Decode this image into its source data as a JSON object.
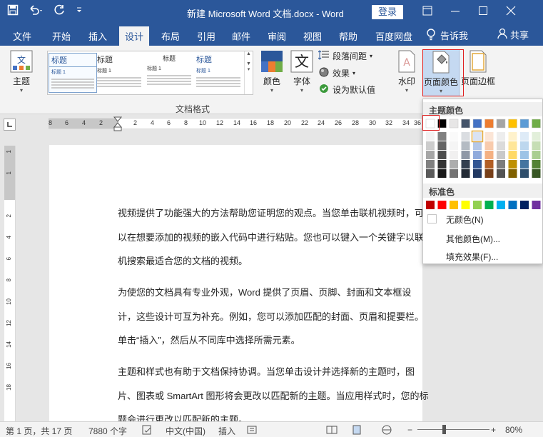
{
  "window": {
    "title": "新建 Microsoft Word 文档.docx  -  Word",
    "login": "登录"
  },
  "tabs": [
    {
      "label": "文件"
    },
    {
      "label": "开始"
    },
    {
      "label": "插入"
    },
    {
      "label": "设计"
    },
    {
      "label": "布局"
    },
    {
      "label": "引用"
    },
    {
      "label": "邮件"
    },
    {
      "label": "审阅"
    },
    {
      "label": "视图"
    },
    {
      "label": "帮助"
    },
    {
      "label": "百度网盘"
    }
  ],
  "tell_me": "告诉我",
  "share": "共享",
  "ribbon": {
    "theme": "主题",
    "colors": "颜色",
    "fonts": "字体",
    "paragraph_spacing": "段落间距",
    "effects": "效果",
    "set_default": "设为默认值",
    "watermark": "水印",
    "page_color": "页面颜色",
    "page_borders": "页面边框",
    "group_label": "文档格式",
    "styles": [
      {
        "name": "标题",
        "heading": "标题 1"
      },
      {
        "name": "标题",
        "heading": "标题 1"
      },
      {
        "name": "标题",
        "heading": "标题 1"
      },
      {
        "name": "标题",
        "heading": "标题 1"
      }
    ]
  },
  "ruler_h": [
    "8",
    "6",
    "4",
    "2",
    "2",
    "4",
    "6",
    "8",
    "10",
    "12",
    "14",
    "16",
    "18",
    "20",
    "22",
    "24",
    "26",
    "28",
    "30",
    "32",
    "34",
    "36"
  ],
  "ruler_v": [
    "1",
    "1",
    "2",
    "4",
    "6",
    "8",
    "10",
    "12",
    "14",
    "16",
    "18"
  ],
  "document": {
    "paragraphs": [
      "视频提供了功能强大的方法帮助您证明您的观点。当您单击联机视频时，可以在想要添加的视频的嵌入代码中进行粘贴。您也可以键入一个关键字以联机搜索最适合您的文档的视频。",
      "为使您的文档具有专业外观，Word 提供了页眉、页脚、封面和文本框设计，这些设计可互为补充。例如，您可以添加匹配的封面、页眉和提要栏。单击“插入”，然后从不同库中选择所需元素。",
      "主题和样式也有助于文档保持协调。当您单击设计并选择新的主题时，图片、图表或 SmartArt 图形将会更改以匹配新的主题。当应用样式时，您的标题会进行更改以匹配新的主题。"
    ]
  },
  "color_menu": {
    "theme_header": "主题颜色",
    "standard_header": "标准色",
    "no_color": "无颜色(N)",
    "more_colors": "其他颜色(M)...",
    "fill_effects": "填充效果(F)...",
    "theme_top": [
      "#ffffff",
      "#000000",
      "#e7e6e6",
      "#44546a",
      "#4472c4",
      "#ed7d31",
      "#a5a5a5",
      "#ffc000",
      "#5b9bd5",
      "#70ad47"
    ],
    "standard": [
      "#c00000",
      "#ff0000",
      "#ffc000",
      "#ffff00",
      "#92d050",
      "#00b050",
      "#00b0f0",
      "#0070c0",
      "#002060",
      "#7030a0"
    ]
  },
  "status": {
    "page": "第 1 页，共 17 页",
    "words": "7880 个字",
    "lang": "中文(中国)",
    "insert": "插入",
    "zoom": "80%"
  }
}
